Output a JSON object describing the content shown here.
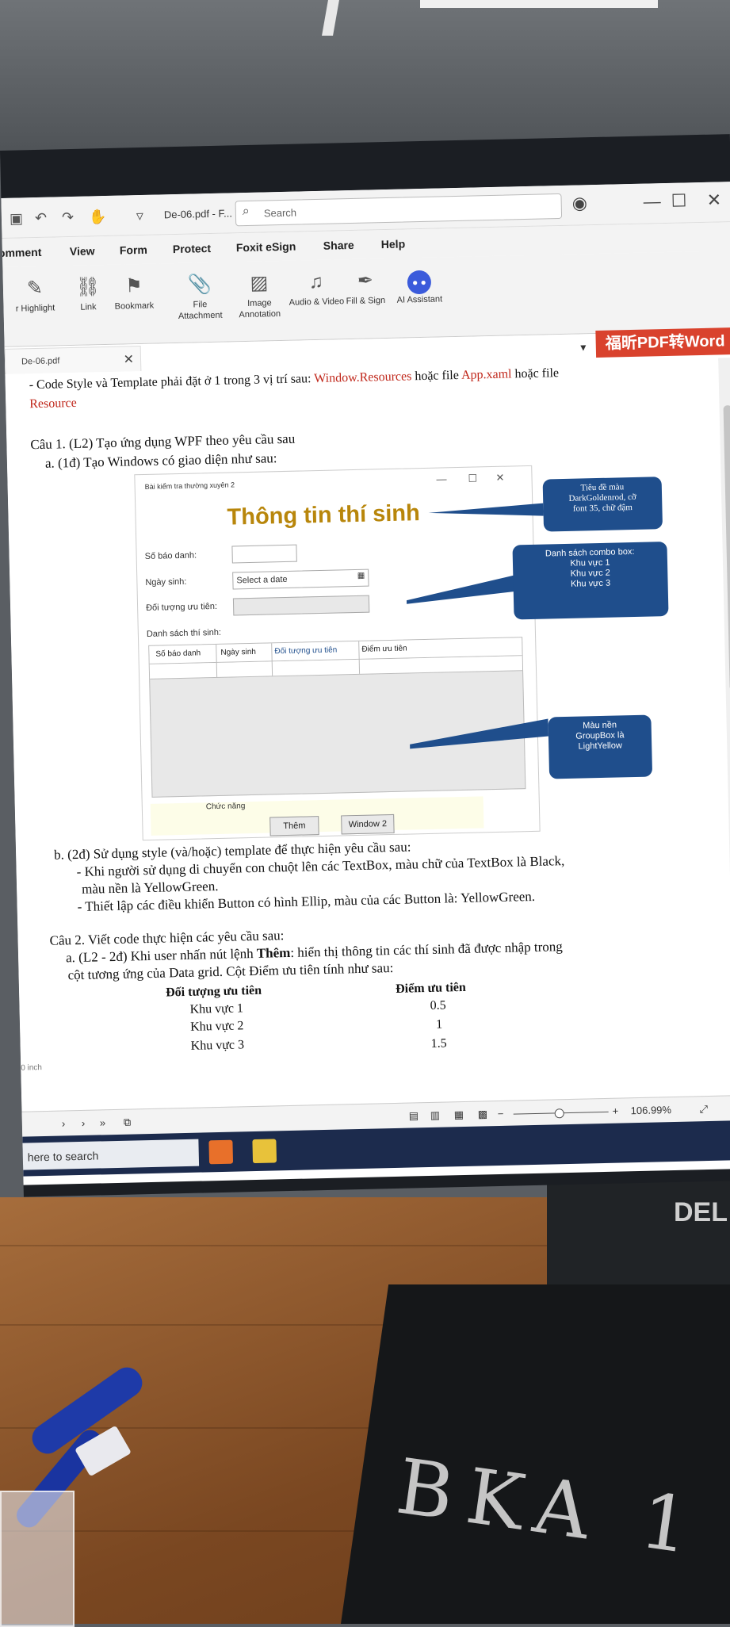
{
  "app": {
    "doc_title": "De-06.pdf - F...",
    "search_placeholder": "Search",
    "menu": [
      "omment",
      "View",
      "Form",
      "Protect",
      "Foxit eSign",
      "Share",
      "Help"
    ],
    "ribbon": [
      {
        "label": "r Highlight",
        "icon": "highlight-icon"
      },
      {
        "label": "Link",
        "icon": "link-icon"
      },
      {
        "label": "Bookmark",
        "icon": "bookmark-icon"
      },
      {
        "label": "File Attachment",
        "icon": "file-attachment-icon"
      },
      {
        "label": "Image Annotation",
        "icon": "image-annotation-icon"
      },
      {
        "label": "Audio & Video",
        "icon": "audio-video-icon"
      },
      {
        "label": "Fill & Sign",
        "icon": "fill-sign-icon"
      },
      {
        "label": "AI Assistant",
        "icon": "ai-assistant-icon"
      }
    ],
    "tab_name": "De-06.pdf",
    "promo": "福昕PDF转Word",
    "status_unit": "0 inch",
    "zoom": "106.99%",
    "taskbar_search": "here to search"
  },
  "doc": {
    "intro_prefix": "- Code Style và Template phải đặt ở 1 trong 3 vị trí sau: ",
    "intro_red1": "Window.Resources",
    "intro_mid": " hoặc file ",
    "intro_red2": "App.xaml",
    "intro_suffix": " hoặc file",
    "intro_red3": "Resource",
    "q1_title": "Câu 1. (L2) Tạo ứng dụng WPF theo yêu cầu sau",
    "q1_a": "a. (1đ) Tạo Windows có giao diện như sau:",
    "q1_b": "b. (2đ) Sử dụng style (và/hoặc) template để thực hiện yêu cầu sau:",
    "q1_b1": "- Khi người sử dụng di chuyển con chuột lên các TextBox, màu chữ của TextBox là Black,",
    "q1_b1_cont": "màu nền là YellowGreen.",
    "q1_b2": "- Thiết lập các điều khiển Button có hình Ellip, màu của các Button là: YellowGreen.",
    "q2_title": "Câu 2. Viết code thực hiện các yêu cầu sau:",
    "q2_a_prefix": "a. (L2 - 2đ) Khi user nhấn nút lệnh ",
    "q2_a_bold": "Thêm",
    "q2_a_suffix": ": hiển thị thông tin các thí sinh đã được nhập trong",
    "q2_a_cont": "cột tương ứng của Data grid. Cột Điểm ưu tiên tính như sau:",
    "table": {
      "headers": [
        "Đối tượng ưu tiên",
        "Điểm ưu tiên"
      ],
      "rows": [
        [
          "Khu vực 1",
          "0.5"
        ],
        [
          "Khu vực 2",
          "1"
        ],
        [
          "Khu vực 3",
          "1.5"
        ]
      ]
    }
  },
  "wpf": {
    "window_title": "Bài kiểm tra thường xuyên 2",
    "header": "Thông tin thí sinh",
    "header_color": "#b8860b",
    "labels": [
      "Số báo danh:",
      "Ngày sinh:",
      "Đối tượng ưu tiên:",
      "Danh sách thí sinh:"
    ],
    "date_placeholder": "Select a date",
    "columns": [
      "Số báo danh",
      "Ngày sinh",
      "Đối tượng ưu tiên",
      "Điểm ưu tiên"
    ],
    "groupbox_title": "Chức năng",
    "groupbox_bg": "#fdfde8",
    "btn_add": "Thêm",
    "btn_window2": "Window 2"
  },
  "callouts": {
    "c1": [
      "Tiêu đề màu",
      "DarkGoldenrod, cỡ",
      "font 35, chữ đậm"
    ],
    "c2": [
      "Danh sách combo box:",
      "Khu vực 1",
      "Khu vực 2",
      "Khu vực 3"
    ],
    "c3": [
      "Màu nền",
      "GroupBox là",
      "LightYellow"
    ],
    "color": "#1f4e8c"
  },
  "scene": {
    "chalk_text": "BKA 1",
    "monitor_brand": "DEL"
  }
}
